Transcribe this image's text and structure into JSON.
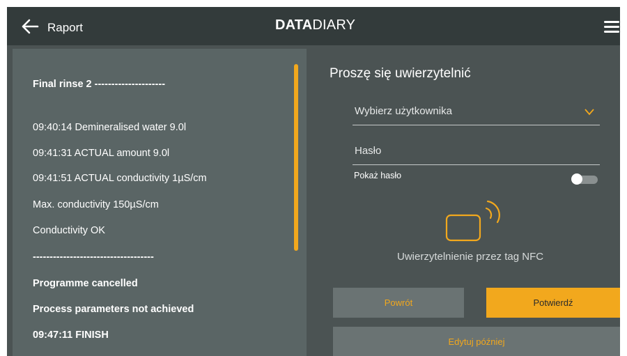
{
  "header": {
    "back_label": "Raport",
    "brand_bold": "DATA",
    "brand_light": "DIARY"
  },
  "report": {
    "lines": [
      {
        "text": "Final rinse 2 ---------------------",
        "bold": true
      },
      {
        "text": "09:40:14 Demineralised water 9.0l",
        "bold": false
      },
      {
        "text": "09:41:31 ACTUAL amount 9.0l",
        "bold": false
      },
      {
        "text": "09:41:51 ACTUAL conductivity 1µS/cm",
        "bold": false
      },
      {
        "text": "Max. conductivity 150µS/cm",
        "bold": false
      },
      {
        "text": "Conductivity OK",
        "bold": false
      },
      {
        "text": "------------------------------------",
        "bold": true
      },
      {
        "text": "Programme cancelled",
        "bold": true
      },
      {
        "text": "Process parameters not achieved",
        "bold": true
      },
      {
        "text": "09:47:11 FINISH",
        "bold": true
      }
    ]
  },
  "auth": {
    "title": "Proszę się uwierzytelnić",
    "user_select": "Wybierz użytkownika",
    "password_label": "Hasło",
    "show_password": "Pokaż hasło",
    "show_password_on": false,
    "nfc_text": "Uwierzytelnienie przez tag NFC",
    "nfc_icon": "nfc-card-icon"
  },
  "buttons": {
    "back": "Powrót",
    "confirm": "Potwierdź",
    "later": "Edytuj później"
  },
  "colors": {
    "accent": "#f2a81d",
    "topbar": "#333b3b",
    "background": "#4b5353",
    "panel": "#5a6565",
    "button_gray": "#6a7373"
  }
}
